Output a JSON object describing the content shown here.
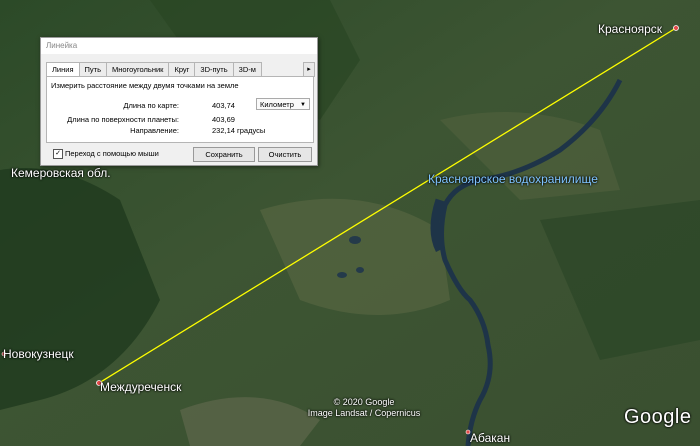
{
  "map": {
    "cities": {
      "krasnoyarsk": "Красноярск",
      "mezhdurechensk": "Междуреченск",
      "novokuznetsk": "Новокузнецк",
      "abakan": "Абакан"
    },
    "region": "Кемеровская обл.",
    "reservoir": "Красноярское водохранилище",
    "attribution_line1": "© 2020 Google",
    "attribution_line2": "Image Landsat / Copernicus",
    "logo": "Google",
    "colors": {
      "measure_line": "#ffff00",
      "water_label": "#7fc4ff",
      "pin": "#e34b4b"
    }
  },
  "ruler": {
    "title": "Линейка",
    "tabs": [
      "Линия",
      "Путь",
      "Многоугольник",
      "Круг",
      "3D-путь",
      "3D-м"
    ],
    "tab_scroll": "▸",
    "description": "Измерить расстояние между двумя точками на земле",
    "map_length_label": "Длина по карте:",
    "map_length_value": "403,74",
    "unit": "Километр",
    "unit_arrow": "▼",
    "surface_length_label": "Длина по поверхности планеты:",
    "surface_length_value": "403,69",
    "heading_label": "Направление:",
    "heading_value": "232,14 градусы",
    "mouse_nav_checked": true,
    "mouse_nav_mark": "✓",
    "mouse_nav_label": "Переход с помощью мыши",
    "save_label": "Сохранить",
    "clear_label": "Очистить"
  }
}
